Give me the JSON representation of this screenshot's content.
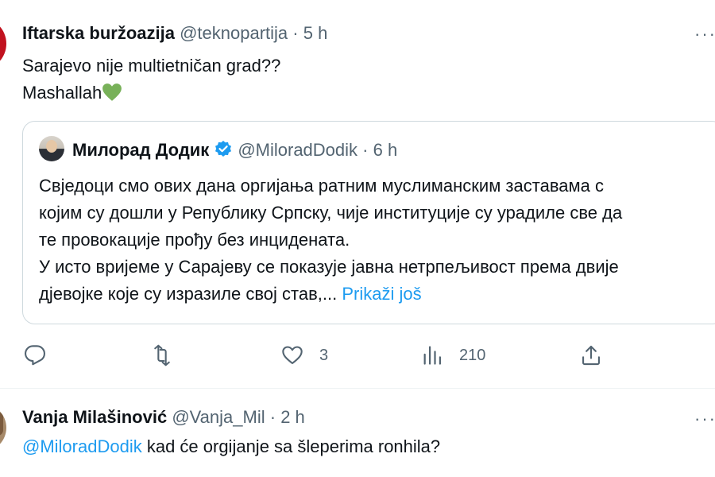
{
  "tweet1": {
    "author_name": "Iftarska buržoazija",
    "handle": "@teknopartija",
    "separator": "·",
    "time": "5 h",
    "more": "···",
    "text_line1": "Sarajevo nije multietničan grad??",
    "text_line2": "Mashallah",
    "emoji": "green-heart-icon",
    "quote": {
      "author_name": "Милорад Додик",
      "verified": "verified-badge-icon",
      "handle": "@MiloradDodik",
      "separator": "·",
      "time": "6 h",
      "lines": [
        "Свједоци смо ових дана оргијања ратним муслиманским заставама с",
        "којим су дошли у Републику Српску, чије институције су урадиле све да",
        "те провокације прођу без инцидената.",
        "У исто вријеме у Сарајеву се показује јавна нетрпељивост према двије",
        "дјевојке које су изразиле свој став,..."
      ],
      "show_more": "Prikaži još"
    },
    "actions": {
      "reply_count": "",
      "retweet_count": "",
      "like_count": "3",
      "views_count": "210"
    }
  },
  "tweet2": {
    "author_name": "Vanja Milašinović",
    "handle": "@Vanja_Mil",
    "separator": "·",
    "time": "2 h",
    "more": "···",
    "mention": "@MiloradDodik",
    "text": " kad će orgijanje sa šleperima ronhila?"
  },
  "colors": {
    "accent": "#1d9bf0",
    "secondary_text": "#536471",
    "border": "#cfd9de",
    "emoji_green": "#5cb85c"
  }
}
